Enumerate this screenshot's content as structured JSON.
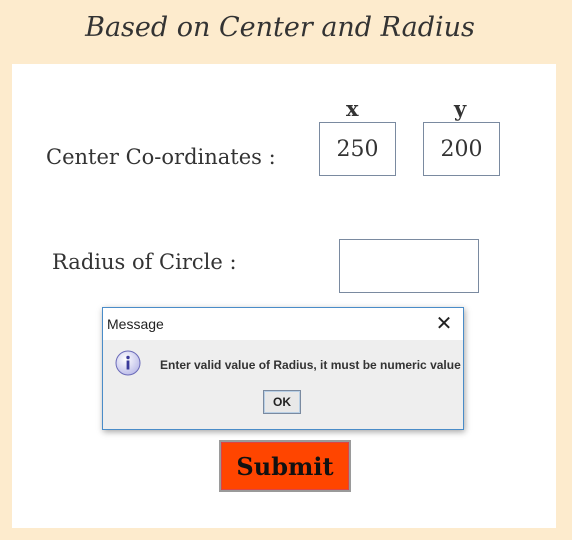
{
  "header": {
    "title": "Based on Center and Radius"
  },
  "form": {
    "center_label": "Center Co-ordinates :",
    "x_label": "x",
    "y_label": "y",
    "x_value": "250",
    "y_value": "200",
    "radius_label": "Radius of Circle :",
    "radius_value": "",
    "submit_label": "Submit"
  },
  "dialog": {
    "title": "Message",
    "close_icon": "close-icon",
    "icon": "info-icon",
    "message": "Enter valid value of Radius, it must be numeric value",
    "ok_label": "OK"
  },
  "colors": {
    "background": "#fdebcd",
    "submit_button": "#ff4500",
    "dialog_border": "#4a8cc8"
  }
}
